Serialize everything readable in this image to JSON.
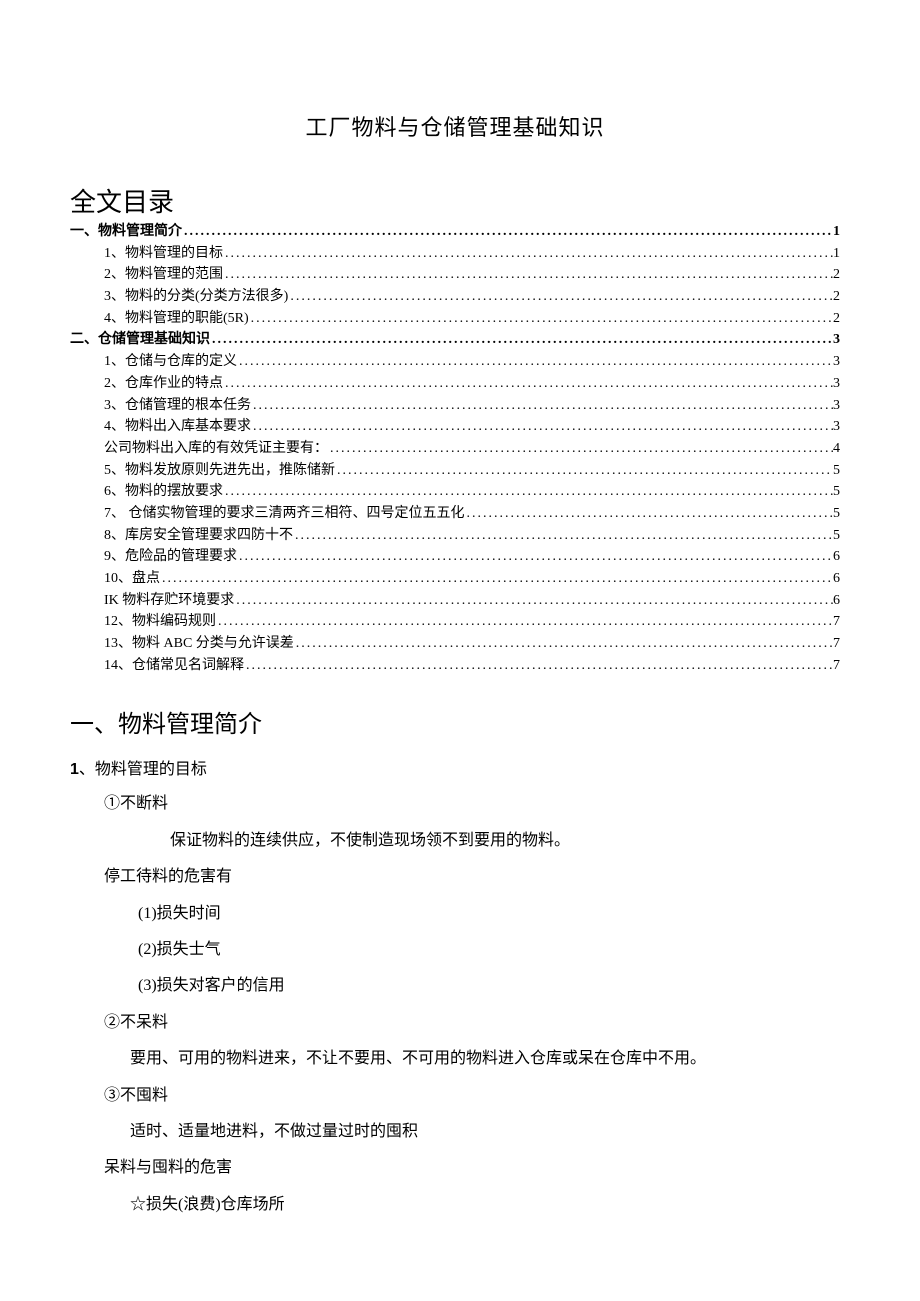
{
  "title": "工厂物料与仓储管理基础知识",
  "toc_header": "全文目录",
  "toc": [
    {
      "level": 1,
      "label": "一、物料管理简介",
      "page": "1"
    },
    {
      "level": 2,
      "label": "1、物料管理的目标",
      "page": "1"
    },
    {
      "level": 2,
      "label": "2、物料管理的范围",
      "page": "2"
    },
    {
      "level": 2,
      "label": "3、物料的分类(分类方法很多)",
      "page": "2"
    },
    {
      "level": 2,
      "label": "4、物料管理的职能(5R)",
      "page": "2"
    },
    {
      "level": 1,
      "label": "二、仓储管理基础知识",
      "page": "3"
    },
    {
      "level": 2,
      "label": "1、仓储与仓库的定义",
      "page": "3"
    },
    {
      "level": 2,
      "label": "2、仓库作业的特点",
      "page": "3"
    },
    {
      "level": 2,
      "label": "3、仓储管理的根本任务",
      "page": "3"
    },
    {
      "level": 2,
      "label": "4、物料出入库基本要求",
      "page": "3"
    },
    {
      "level": 2,
      "label": "公司物料出入库的有效凭证主要有：",
      "page": "4"
    },
    {
      "level": 2,
      "label": "5、物料发放原则先进先出，推陈储新",
      "page": "5"
    },
    {
      "level": 2,
      "label": "6、物料的摆放要求",
      "page": "5"
    },
    {
      "level": 2,
      "label": "7、 仓储实物管理的要求三清两齐三相符、四号定位五五化",
      "page": "5"
    },
    {
      "level": 2,
      "label": "8、库房安全管理要求四防十不",
      "page": "5"
    },
    {
      "level": 2,
      "label": "9、危险品的管理要求",
      "page": "6"
    },
    {
      "level": 2,
      "label": "10、盘点",
      "page": "6"
    },
    {
      "level": 2,
      "label": "IK 物料存贮环境要求",
      "page": "6"
    },
    {
      "level": 2,
      "label": "12、物料编码规则",
      "page": "7"
    },
    {
      "level": 2,
      "label": "13、物料 ABC 分类与允许误差",
      "page": "7"
    },
    {
      "level": 2,
      "label": "14、仓储常见名词解释",
      "page": "7"
    }
  ],
  "section1_title": "一、物料管理简介",
  "sub1": {
    "num": "1",
    "text": "、物料管理的目标"
  },
  "body": {
    "b1": "①不断料",
    "b2": "保证物料的连续供应，不使制造现场领不到要用的物料。",
    "b3": "停工待料的危害有",
    "b4": "(1)损失时间",
    "b5": "(2)损失士气",
    "b6": "(3)损失对客户的信用",
    "b7": "②不呆料",
    "b8": "要用、可用的物料进来，不让不要用、不可用的物料进入仓库或呆在仓库中不用。",
    "b9": "③不囤料",
    "b10": "适时、适量地进料，不做过量过时的囤积",
    "b11": "呆料与囤料的危害",
    "b12": "☆损失(浪费)仓库场所"
  }
}
